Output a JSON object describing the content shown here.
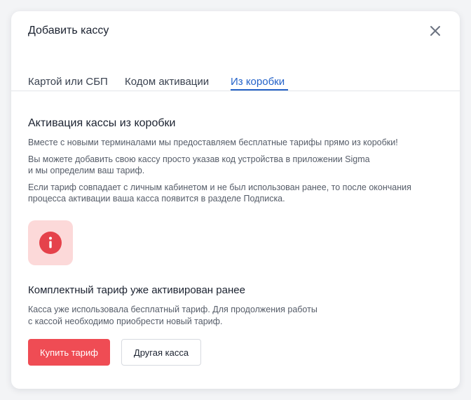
{
  "modal": {
    "title": "Добавить кассу",
    "close_icon": "close-icon"
  },
  "tabs": [
    {
      "label": "Картой или СБП",
      "active": false
    },
    {
      "label": "Кодом активации",
      "active": false
    },
    {
      "label": "Из коробки",
      "active": true
    }
  ],
  "section": {
    "title": "Активация кассы из коробки",
    "paragraphs": [
      "Вместе с новыми терминалами мы предоставляем бесплатные тарифы прямо из коробки!",
      "Вы можете добавить свою кассу просто указав код устройства в приложении Sigma\nи мы определим ваш тариф.",
      "Если тариф совпадает с личным кабинетом и не был использован ранее, то после окончания\nпроцесса активации ваша касса появится в разделе Подписка."
    ]
  },
  "notice": {
    "icon": "info-icon",
    "title": "Комплектный тариф уже активирован ранее",
    "text": "Касса уже использовала бесплатный тариф. Для продолжения работы\nс кассой необходимо приобрести новый тариф."
  },
  "actions": {
    "primary_label": "Купить тариф",
    "secondary_label": "Другая касса"
  },
  "colors": {
    "accent": "#2563c9",
    "danger": "#ef4c54",
    "danger_light": "#fcd9d9",
    "icon_red": "#e5424b"
  }
}
